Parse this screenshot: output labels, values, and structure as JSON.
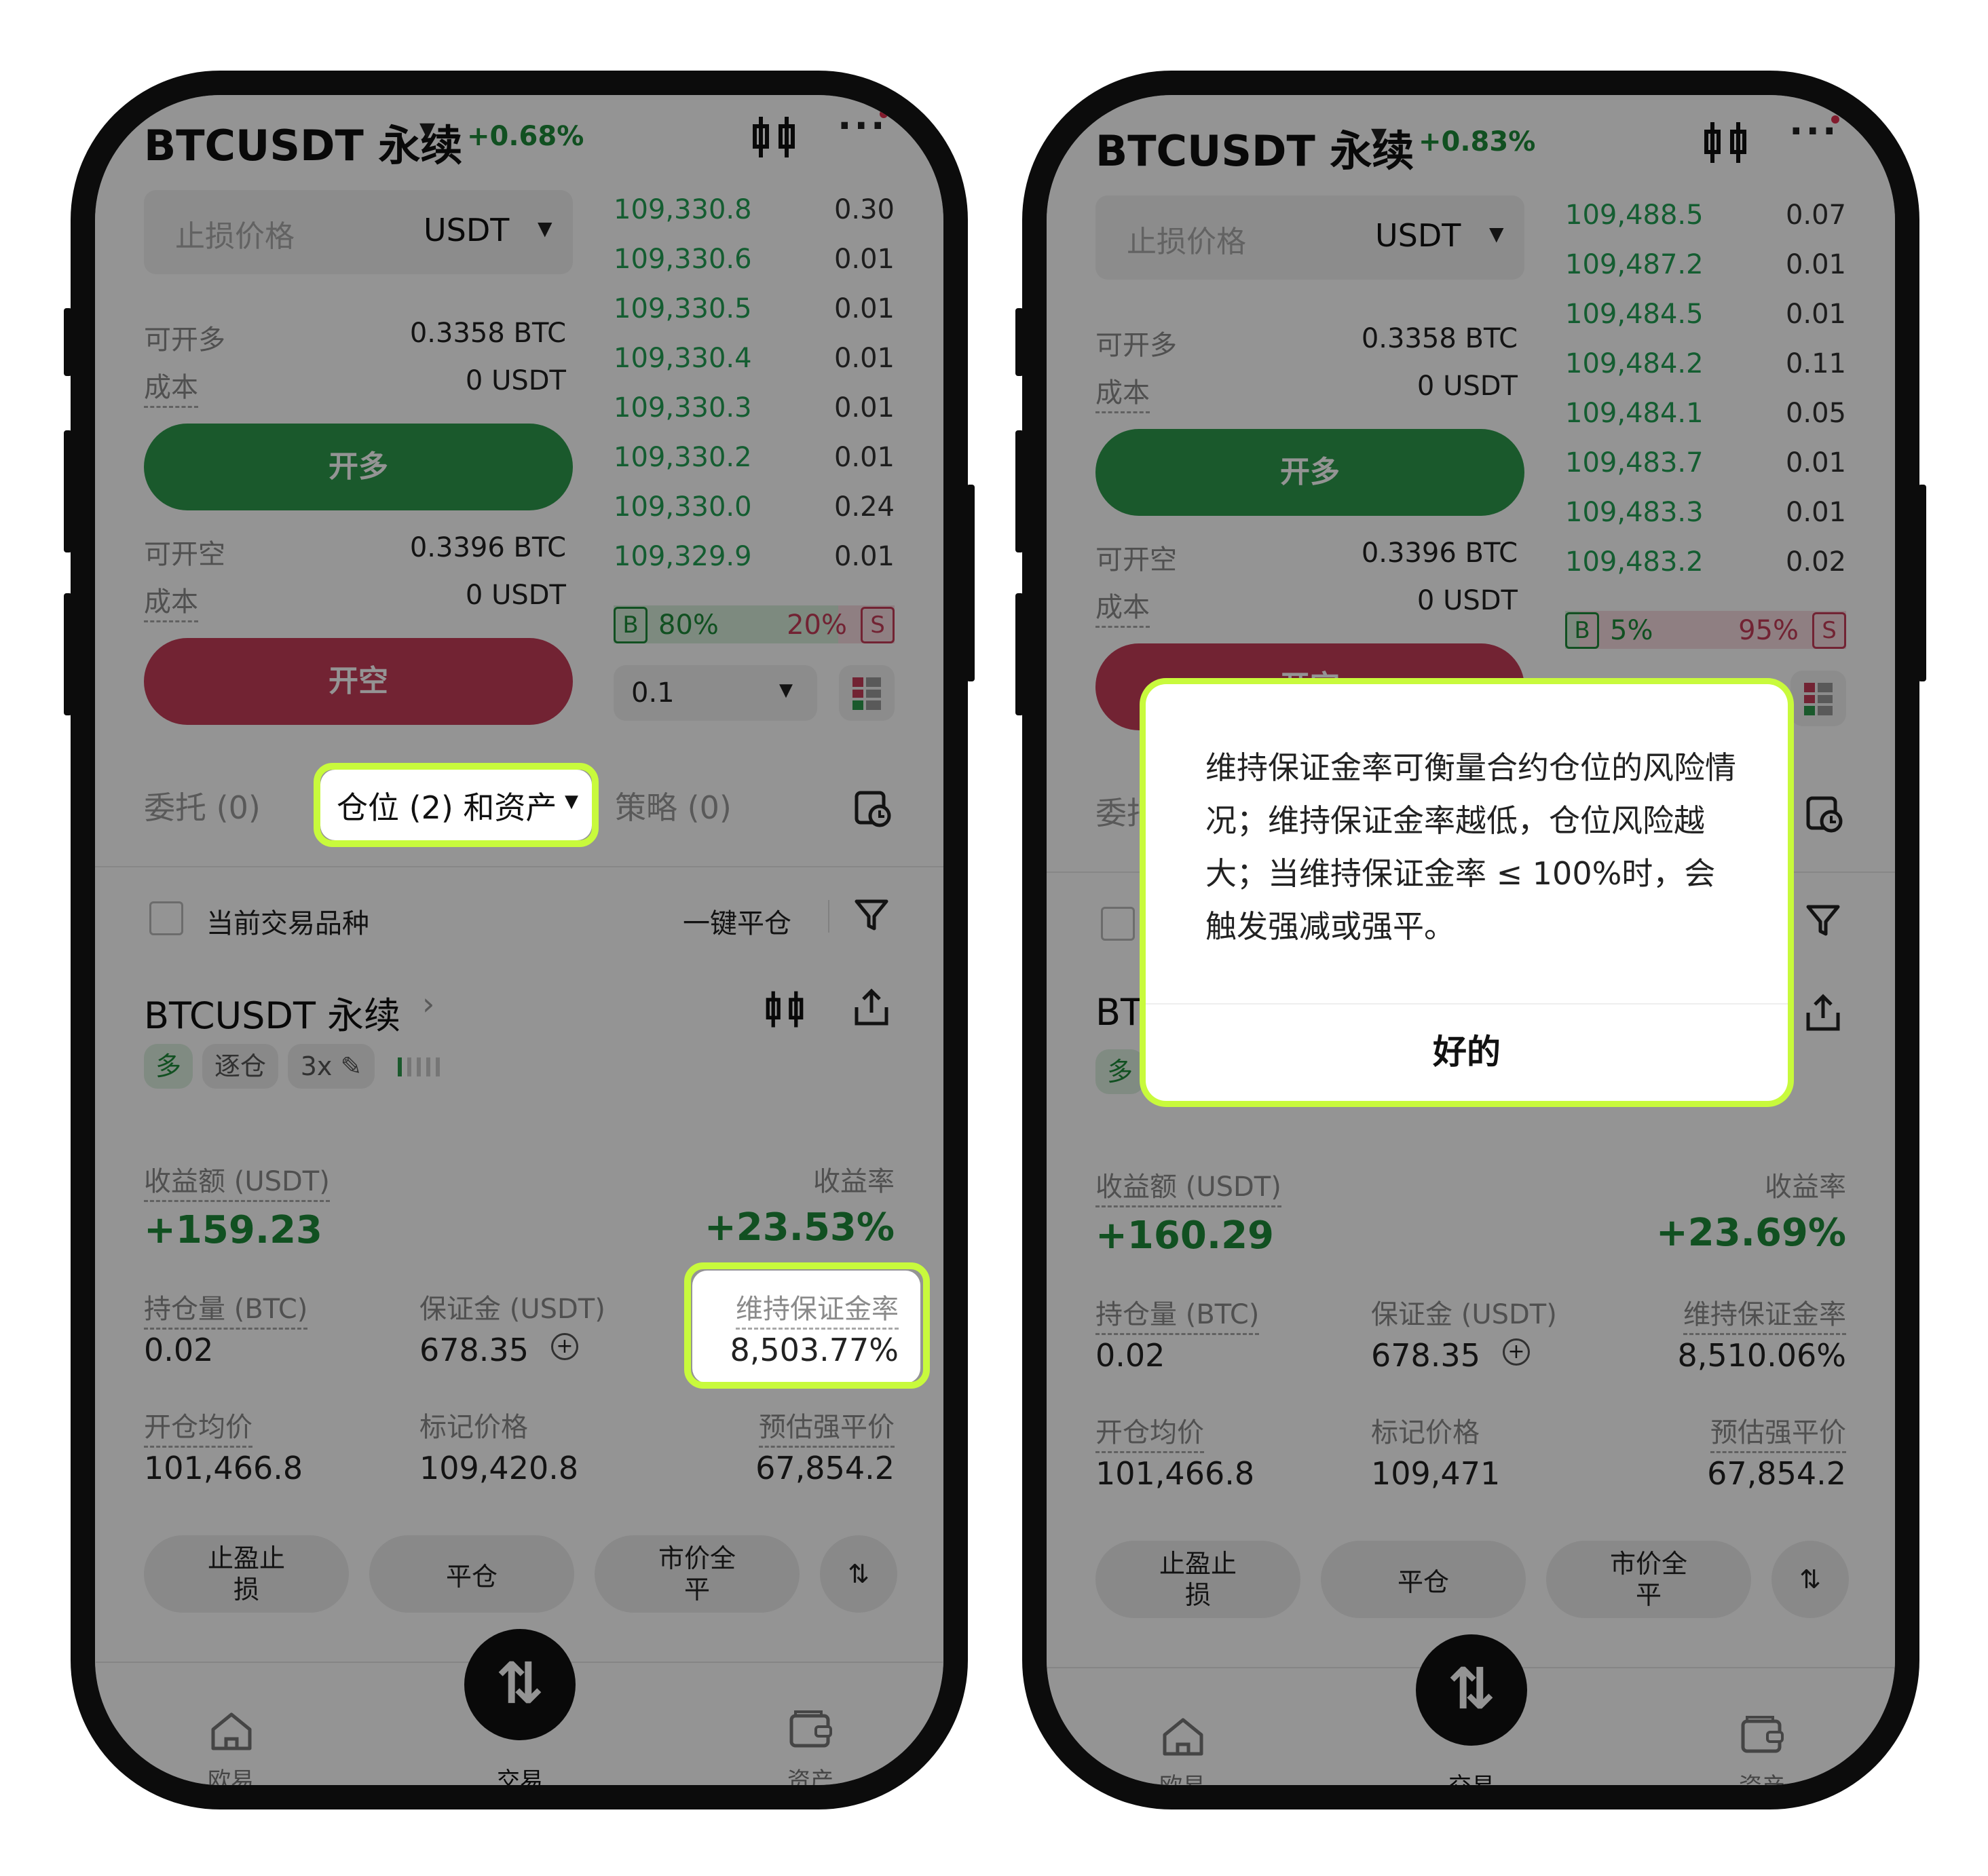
{
  "left": {
    "header": {
      "title": "BTCUSDT 永续",
      "change": "+0.68%"
    },
    "stop_input": {
      "placeholder": "止损价格",
      "unit": "USDT"
    },
    "long": {
      "label_avail": "可开多",
      "avail": "0.3358 BTC",
      "label_cost": "成本",
      "cost": "0 USDT",
      "button": "开多"
    },
    "short": {
      "label_avail": "可开空",
      "avail": "0.3396 BTC",
      "label_cost": "成本",
      "cost": "0 USDT",
      "button": "开空"
    },
    "orderbook": {
      "rows": [
        {
          "price": "109,330.8",
          "qty": "0.30"
        },
        {
          "price": "109,330.6",
          "qty": "0.01"
        },
        {
          "price": "109,330.5",
          "qty": "0.01"
        },
        {
          "price": "109,330.4",
          "qty": "0.01"
        },
        {
          "price": "109,330.3",
          "qty": "0.01"
        },
        {
          "price": "109,330.2",
          "qty": "0.01"
        },
        {
          "price": "109,330.0",
          "qty": "0.24"
        },
        {
          "price": "109,329.9",
          "qty": "0.01"
        }
      ],
      "buy_label": "B",
      "buy_pct": "80%",
      "sell_pct": "20%",
      "sell_label": "S",
      "buy_ratio": 0.8,
      "step": "0.1"
    },
    "tabs": {
      "orders": "委托 (0)",
      "positions": "仓位 (2) 和资产",
      "strategy": "策略 (0)"
    },
    "filter": {
      "checkbox_label": "当前交易品种",
      "close_all": "一键平仓"
    },
    "position": {
      "name": "BTCUSDT 永续",
      "tag_side": "多",
      "tag_mode": "逐仓",
      "tag_lev": "3x",
      "pnl_label": "收益额 (USDT)",
      "pnl": "+159.23",
      "roe_label": "收益率",
      "roe": "+23.53%",
      "size_label": "持仓量 (BTC)",
      "size": "0.02",
      "margin_label": "保证金 (USDT)",
      "margin": "678.35",
      "mmr_label": "维持保证金率",
      "mmr": "8,503.77%",
      "entry_label": "开仓均价",
      "entry": "101,466.8",
      "mark_label": "标记价格",
      "mark": "109,420.8",
      "liq_label": "预估强平价",
      "liq": "67,854.2"
    },
    "actions": {
      "tpsl": "止盈止\n损",
      "close": "平仓",
      "market_close": "市价全\n平"
    },
    "nav": {
      "home": "欧易",
      "trade": "交易",
      "assets": "资产"
    }
  },
  "right": {
    "header": {
      "title": "BTCUSDT 永续",
      "change": "+0.83%"
    },
    "stop_input": {
      "placeholder": "止损价格",
      "unit": "USDT"
    },
    "long": {
      "label_avail": "可开多",
      "avail": "0.3358 BTC",
      "label_cost": "成本",
      "cost": "0 USDT",
      "button": "开多"
    },
    "short": {
      "label_avail": "可开空",
      "avail": "0.3396 BTC",
      "label_cost": "成本",
      "cost": "0 USDT",
      "button": "开空"
    },
    "orderbook": {
      "rows": [
        {
          "price": "109,488.5",
          "qty": "0.07"
        },
        {
          "price": "109,487.2",
          "qty": "0.01"
        },
        {
          "price": "109,484.5",
          "qty": "0.01"
        },
        {
          "price": "109,484.2",
          "qty": "0.11"
        },
        {
          "price": "109,484.1",
          "qty": "0.05"
        },
        {
          "price": "109,483.7",
          "qty": "0.01"
        },
        {
          "price": "109,483.3",
          "qty": "0.01"
        },
        {
          "price": "109,483.2",
          "qty": "0.02"
        }
      ],
      "buy_label": "B",
      "buy_pct": "5%",
      "sell_pct": "95%",
      "sell_label": "S",
      "buy_ratio": 0.05
    },
    "tabs": {
      "orders": "委托"
    },
    "position": {
      "name": "BT",
      "tag_side": "多",
      "pnl_label": "收益额 (USDT)",
      "pnl": "+160.29",
      "roe_label": "收益率",
      "roe": "+23.69%",
      "size_label": "持仓量 (BTC)",
      "size": "0.02",
      "margin_label": "保证金 (USDT)",
      "margin": "678.35",
      "mmr_label": "维持保证金率",
      "mmr": "8,510.06%",
      "entry_label": "开仓均价",
      "entry": "101,466.8",
      "mark_label": "标记价格",
      "mark": "109,471",
      "liq_label": "预估强平价",
      "liq": "67,854.2"
    },
    "actions": {
      "tpsl": "止盈止\n损",
      "close": "平仓",
      "market_close": "市价全\n平"
    },
    "nav": {
      "home": "欧易",
      "trade": "交易",
      "assets": "资产"
    },
    "dialog": {
      "message": "维持保证金率可衡量合约仓位的风险情况；维持保证金率越低，仓位风险越大；当维持保证金率 ≤ 100%时，会触发强减或强平。",
      "ok": "好的"
    }
  },
  "colors": {
    "green": "#1e8a3a",
    "long_btn": "#2e9a4c",
    "short_btn": "#c43d58",
    "highlight": "#c8fa3c"
  }
}
